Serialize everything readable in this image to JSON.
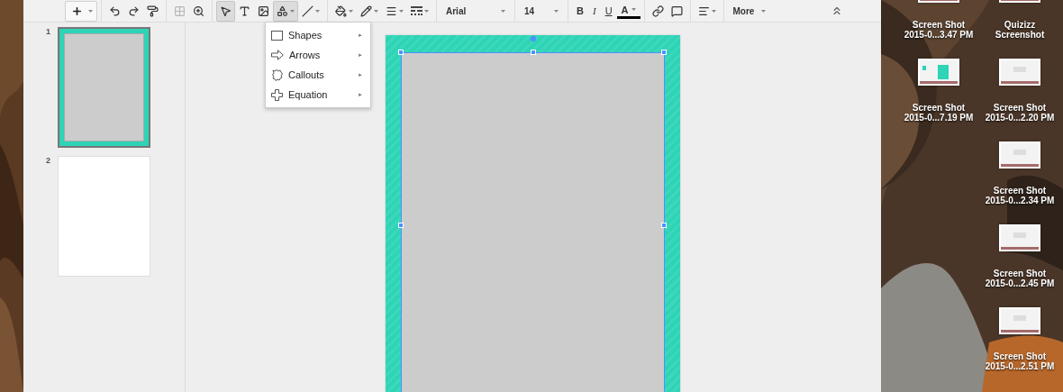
{
  "toolbar": {
    "items": [
      {
        "kind": "split"
      },
      {
        "kind": "separator"
      },
      {
        "kind": "icon",
        "selected": false,
        "disabled": false
      },
      {
        "kind": "icon",
        "selected": false,
        "disabled": false
      },
      {
        "kind": "icon",
        "selected": false,
        "disabled": false
      },
      {
        "kind": "separator"
      },
      {
        "kind": "icon",
        "selected": false,
        "disabled": true
      },
      {
        "kind": "icon",
        "selected": false,
        "disabled": false
      },
      {
        "kind": "separator"
      },
      {
        "kind": "icon",
        "selected": true,
        "disabled": false
      },
      {
        "kind": "icon",
        "selected": false,
        "disabled": false
      },
      {
        "kind": "icon",
        "selected": false,
        "disabled": false
      },
      {
        "kind": "icon",
        "selected": true,
        "disabled": false
      },
      {
        "kind": "icon",
        "selected": false,
        "disabled": false
      },
      {
        "kind": "separator"
      },
      {
        "kind": "icon",
        "selected": false,
        "disabled": false
      },
      {
        "kind": "icon",
        "selected": false,
        "disabled": false
      },
      {
        "kind": "icon",
        "selected": false,
        "disabled": false
      },
      {
        "kind": "icon",
        "selected": false,
        "disabled": false
      },
      {
        "kind": "separator"
      },
      {
        "kind": "dropdown",
        "value": "Arial"
      },
      {
        "kind": "separator"
      },
      {
        "kind": "dropdown",
        "value": "14"
      },
      {
        "kind": "separator"
      },
      {
        "kind": "letter",
        "label": "B"
      },
      {
        "kind": "letter",
        "label": "I"
      },
      {
        "kind": "letter",
        "label": "U"
      },
      {
        "kind": "letter",
        "label": "A"
      },
      {
        "kind": "separator"
      },
      {
        "kind": "icon",
        "selected": false,
        "disabled": false
      },
      {
        "kind": "icon",
        "selected": false,
        "disabled": false
      },
      {
        "kind": "separator"
      },
      {
        "kind": "icon",
        "selected": false,
        "disabled": false
      },
      {
        "kind": "separator"
      },
      {
        "kind": "dropdown",
        "value": "More"
      },
      {
        "kind": "collapse"
      }
    ]
  },
  "shape_menu": {
    "open": true,
    "items": [
      {
        "label": "Shapes",
        "arrow": "►"
      },
      {
        "label": "Arrows",
        "arrow": "►"
      },
      {
        "label": "Callouts",
        "arrow": "►"
      },
      {
        "label": "Equation",
        "arrow": "►"
      }
    ]
  },
  "filmstrip": [
    {
      "number": "1",
      "selected": true,
      "kind": "bordered"
    },
    {
      "number": "2",
      "selected": false,
      "kind": "blank"
    }
  ],
  "slide": {
    "shape_selected": true
  },
  "desktop": {
    "columns": [
      [
        {
          "lines": [
            "Screen Shot",
            "2015-0...3.47 PM"
          ]
        },
        {
          "lines": [
            "Screen Shot",
            "2015-0...7.19 PM"
          ]
        }
      ],
      [
        {
          "lines": [
            "Quizizz",
            "Screenshot"
          ]
        },
        {
          "lines": [
            "Screen Shot",
            "2015-0...2.20 PM"
          ]
        },
        {
          "lines": [
            "Screen Shot",
            "2015-0...2.34 PM"
          ]
        },
        {
          "lines": [
            "Screen Shot",
            "2015-0...2.45 PM"
          ]
        },
        {
          "lines": [
            "Screen Shot",
            "2015-0...2.51 PM"
          ]
        }
      ]
    ]
  }
}
